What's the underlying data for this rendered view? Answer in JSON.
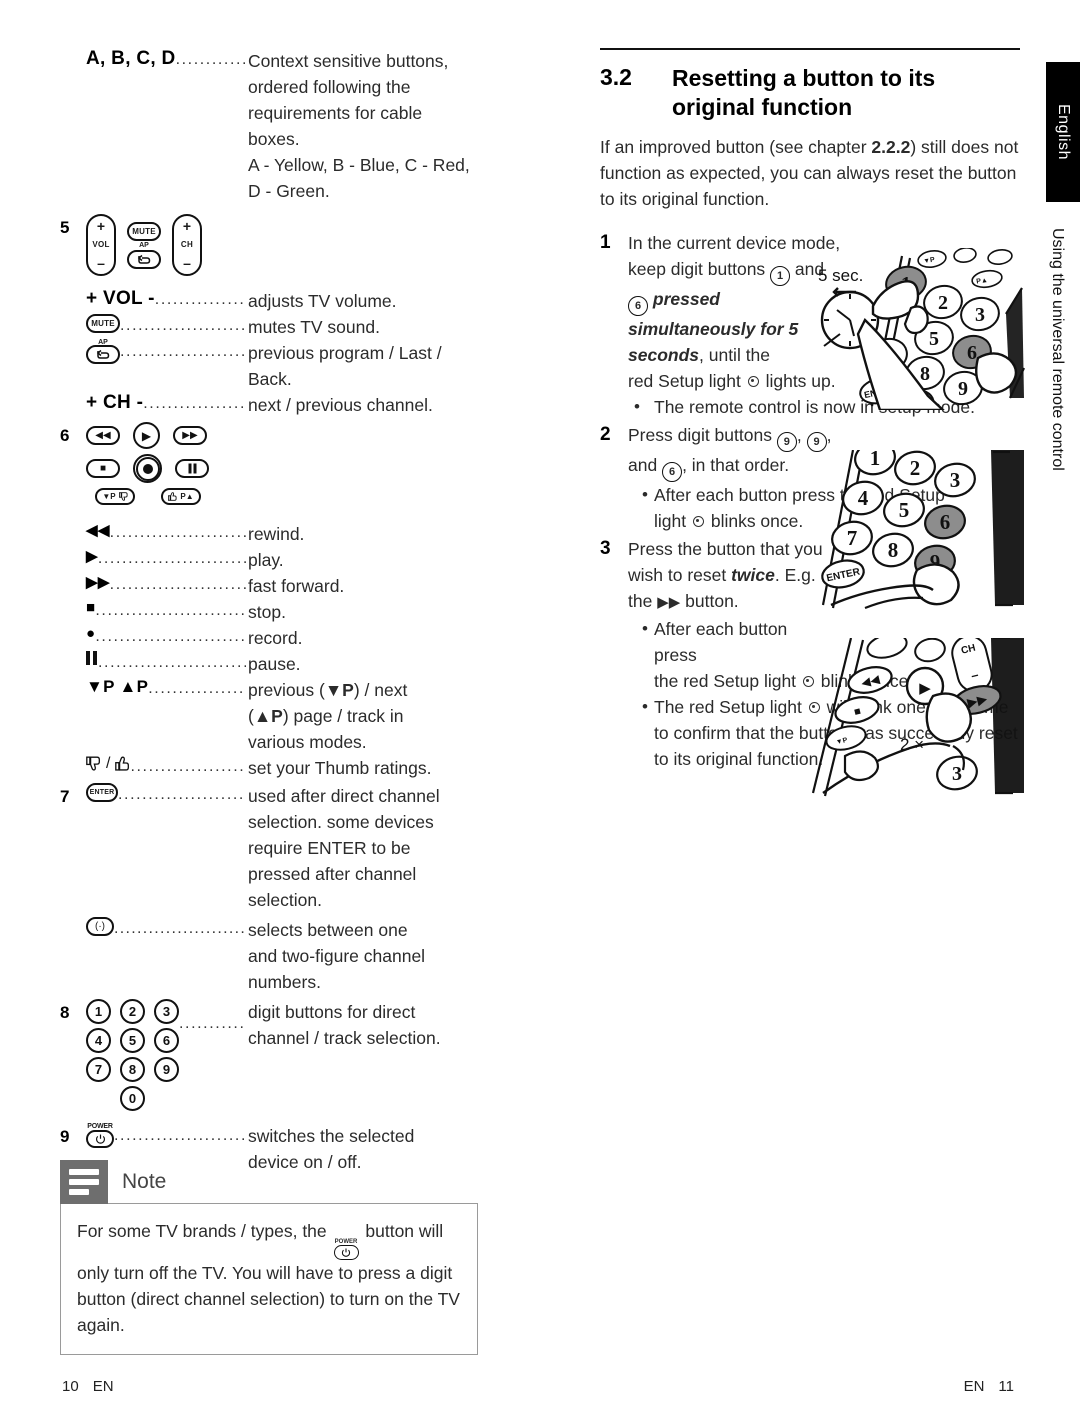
{
  "left_page": {
    "entries": [
      {
        "number": "",
        "term_text": "A, B, C, D",
        "term_kind": "text",
        "leader": true,
        "description": "Context sensitive buttons, ordered following the requirements for cable boxes.\nA - Yellow, B - Blue, C - Red, D - Green."
      },
      {
        "number": "5",
        "term_kind": "vol-mute-ch-cluster",
        "cluster": {
          "vol_plus": "+",
          "vol_label": "VOL",
          "vol_minus": "–",
          "mute_label": "MUTE",
          "ap_label": "AP",
          "back_glyph": "↶",
          "ch_plus": "+",
          "ch_label": "CH",
          "ch_minus": "–"
        },
        "description": ""
      },
      {
        "number": "",
        "term_text": "+ VOL -",
        "term_kind": "text",
        "leader": true,
        "description": "adjusts TV volume."
      },
      {
        "number": "",
        "term_kind": "mute-pill",
        "leader": true,
        "description": "mutes TV sound."
      },
      {
        "number": "",
        "term_kind": "back-pill",
        "leader": true,
        "description": "previous program / Last / Back."
      },
      {
        "number": "",
        "term_text": "+ CH -",
        "term_kind": "text",
        "leader": true,
        "description": "next / previous channel."
      },
      {
        "number": "6",
        "term_kind": "transport-cluster",
        "description": ""
      },
      {
        "number": "",
        "term_kind": "glyph-rewind",
        "leader": true,
        "description": "rewind."
      },
      {
        "number": "",
        "term_kind": "glyph-play",
        "leader": true,
        "description": "play."
      },
      {
        "number": "",
        "term_kind": "glyph-ff",
        "leader": true,
        "description": "fast forward."
      },
      {
        "number": "",
        "term_kind": "glyph-stop",
        "leader": true,
        "description": "stop."
      },
      {
        "number": "",
        "term_kind": "glyph-record",
        "leader": true,
        "description": "record."
      },
      {
        "number": "",
        "term_kind": "glyph-pause",
        "leader": true,
        "description": "pause."
      },
      {
        "number": "",
        "term_text": "▼P ▲P",
        "term_kind": "text",
        "leader": true,
        "description": "previous (▼P) / next (▲P) page / track in various modes."
      },
      {
        "number": "",
        "term_kind": "thumbs",
        "leader": true,
        "description": "set your Thumb ratings."
      },
      {
        "number": "7",
        "term_kind": "enter-pill",
        "leader": true,
        "description": "used after direct channel selection. some devices require ENTER to be pressed after channel selection."
      },
      {
        "number": "",
        "term_kind": "dot-pill",
        "leader": true,
        "description": "selects between one and two-figure channel numbers."
      },
      {
        "number": "8",
        "term_kind": "keypad",
        "leader": true,
        "description": "digit buttons for direct channel / track selection."
      },
      {
        "number": "9",
        "term_kind": "power-pill",
        "leader": true,
        "description": "switches the selected device on / off."
      }
    ],
    "keypad_rows": [
      [
        "1",
        "2",
        "3"
      ],
      [
        "4",
        "5",
        "6"
      ],
      [
        "7",
        "8",
        "9"
      ],
      [
        "0"
      ]
    ],
    "enter_label": "ENTER",
    "dot_label": "(·)",
    "power_label": "POWER",
    "power_glyph": "⏻",
    "thumb_down": "👎",
    "thumb_up": "👍",
    "glyphs": {
      "rewind": "◀◀",
      "play": "▶",
      "fast_forward": "▶▶",
      "stop": "■",
      "record": "●",
      "pause": "▐▐"
    },
    "note": {
      "title": "Note",
      "text_before": "For some TV brands / types, the ",
      "power_label": "POWER",
      "text_after": " button will only turn off the TV. You will have to press a digit button (direct channel selection) to turn on the TV again."
    }
  },
  "right_page": {
    "section_number": "3.2",
    "section_title": "Resetting a button to its original function",
    "intro": "If an improved button (see chapter 2.2.2) still does not function as expected, you can always reset the button to its original function.",
    "intro_ref": "2.2.2",
    "steps": [
      {
        "number": "1",
        "lines": [
          "In the current",
          "device mode, keep",
          "digit buttons ①",
          "and ⑥ pressed",
          "simultaneously for 5",
          "seconds, until the",
          "red Setup light ◎ lights up."
        ],
        "emphasis": "pressed simultaneously for 5 seconds",
        "bullets": [
          "The remote control is now in setup mode."
        ],
        "illustration": {
          "label": "5 sec.",
          "highlighted_keys": [
            "1",
            "6"
          ]
        }
      },
      {
        "number": "2",
        "lines": [
          "Press digit buttons",
          "⑨, ⑨, and ⑥, in",
          "that order."
        ],
        "bullets": [
          "After each button press the red Setup light ◎ blinks once."
        ],
        "illustration": {
          "label": "",
          "highlighted_keys": [
            "6",
            "9"
          ]
        }
      },
      {
        "number": "3",
        "lines": [
          "Press the button",
          "that you wish to",
          "reset twice. E.g. the",
          "▶▶ button."
        ],
        "emphasis": "twice",
        "bullets": [
          "After each button press the red Setup light ◎ blinks once.",
          "The red Setup light ◎ will blink one more time to confirm that the button was succesfully reset to its original function."
        ],
        "illustration": {
          "label": "2 ×",
          "highlighted_keys": [
            "fast-forward"
          ]
        }
      }
    ]
  },
  "sidebar": {
    "language_tab": "English",
    "chapter_label": "Using the universal remote control"
  },
  "footer": {
    "left_page_number": "10",
    "left_lang": "EN",
    "right_lang": "EN",
    "right_page_number": "11"
  }
}
